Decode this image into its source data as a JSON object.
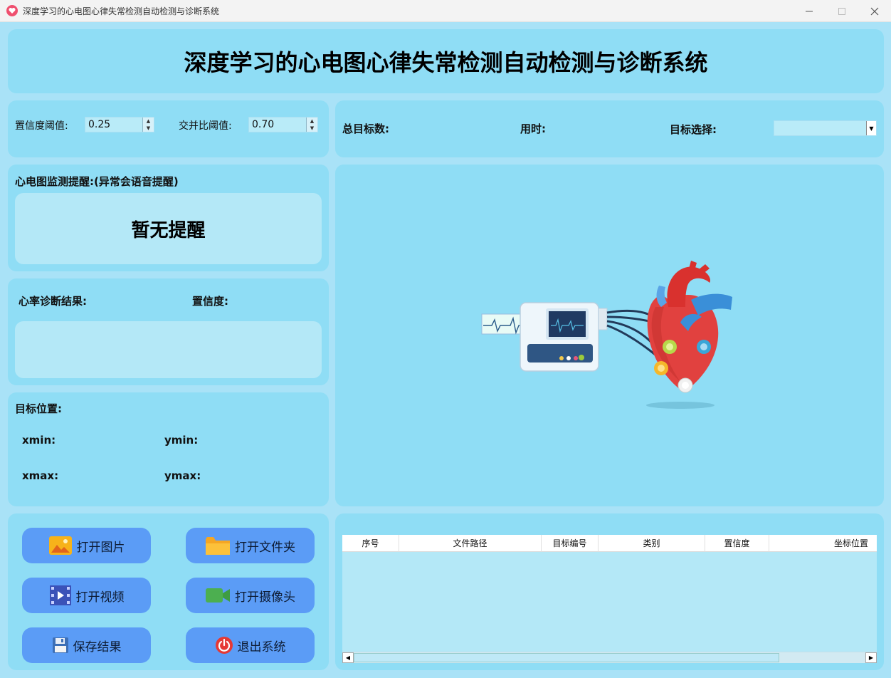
{
  "window": {
    "title": "深度学习的心电图心律失常检测自动检测与诊断系统"
  },
  "header": {
    "title": "深度学习的心电图心律失常检测自动检测与诊断系统"
  },
  "params": {
    "confidence_label": "置信度阈值:",
    "confidence_value": "0.25",
    "iou_label": "交并比阈值:",
    "iou_value": "0.70"
  },
  "stats": {
    "total_label": "总目标数:",
    "time_label": "用时:",
    "target_select_label": "目标选择:",
    "target_select_value": ""
  },
  "alert": {
    "title": "心电图监测提醒:(异常会语音提醒)",
    "message": "暂无提醒"
  },
  "diagnosis": {
    "result_label": "心率诊断结果:",
    "confidence_label": "置信度:"
  },
  "position": {
    "title": "目标位置:",
    "xmin": "xmin:",
    "ymin": "ymin:",
    "xmax": "xmax:",
    "ymax": "ymax:"
  },
  "buttons": {
    "open_image": "打开图片",
    "open_folder": "打开文件夹",
    "open_video": "打开视频",
    "open_camera": "打开摄像头",
    "save_result": "保存结果",
    "exit": "退出系统"
  },
  "table": {
    "columns": [
      "序号",
      "文件路径",
      "目标编号",
      "类别",
      "置信度",
      "坐标位置"
    ]
  },
  "icons": {
    "open_image": "image-icon",
    "open_folder": "folder-icon",
    "open_video": "film-icon",
    "open_camera": "camera-icon",
    "save_result": "floppy-icon",
    "exit": "power-icon"
  }
}
